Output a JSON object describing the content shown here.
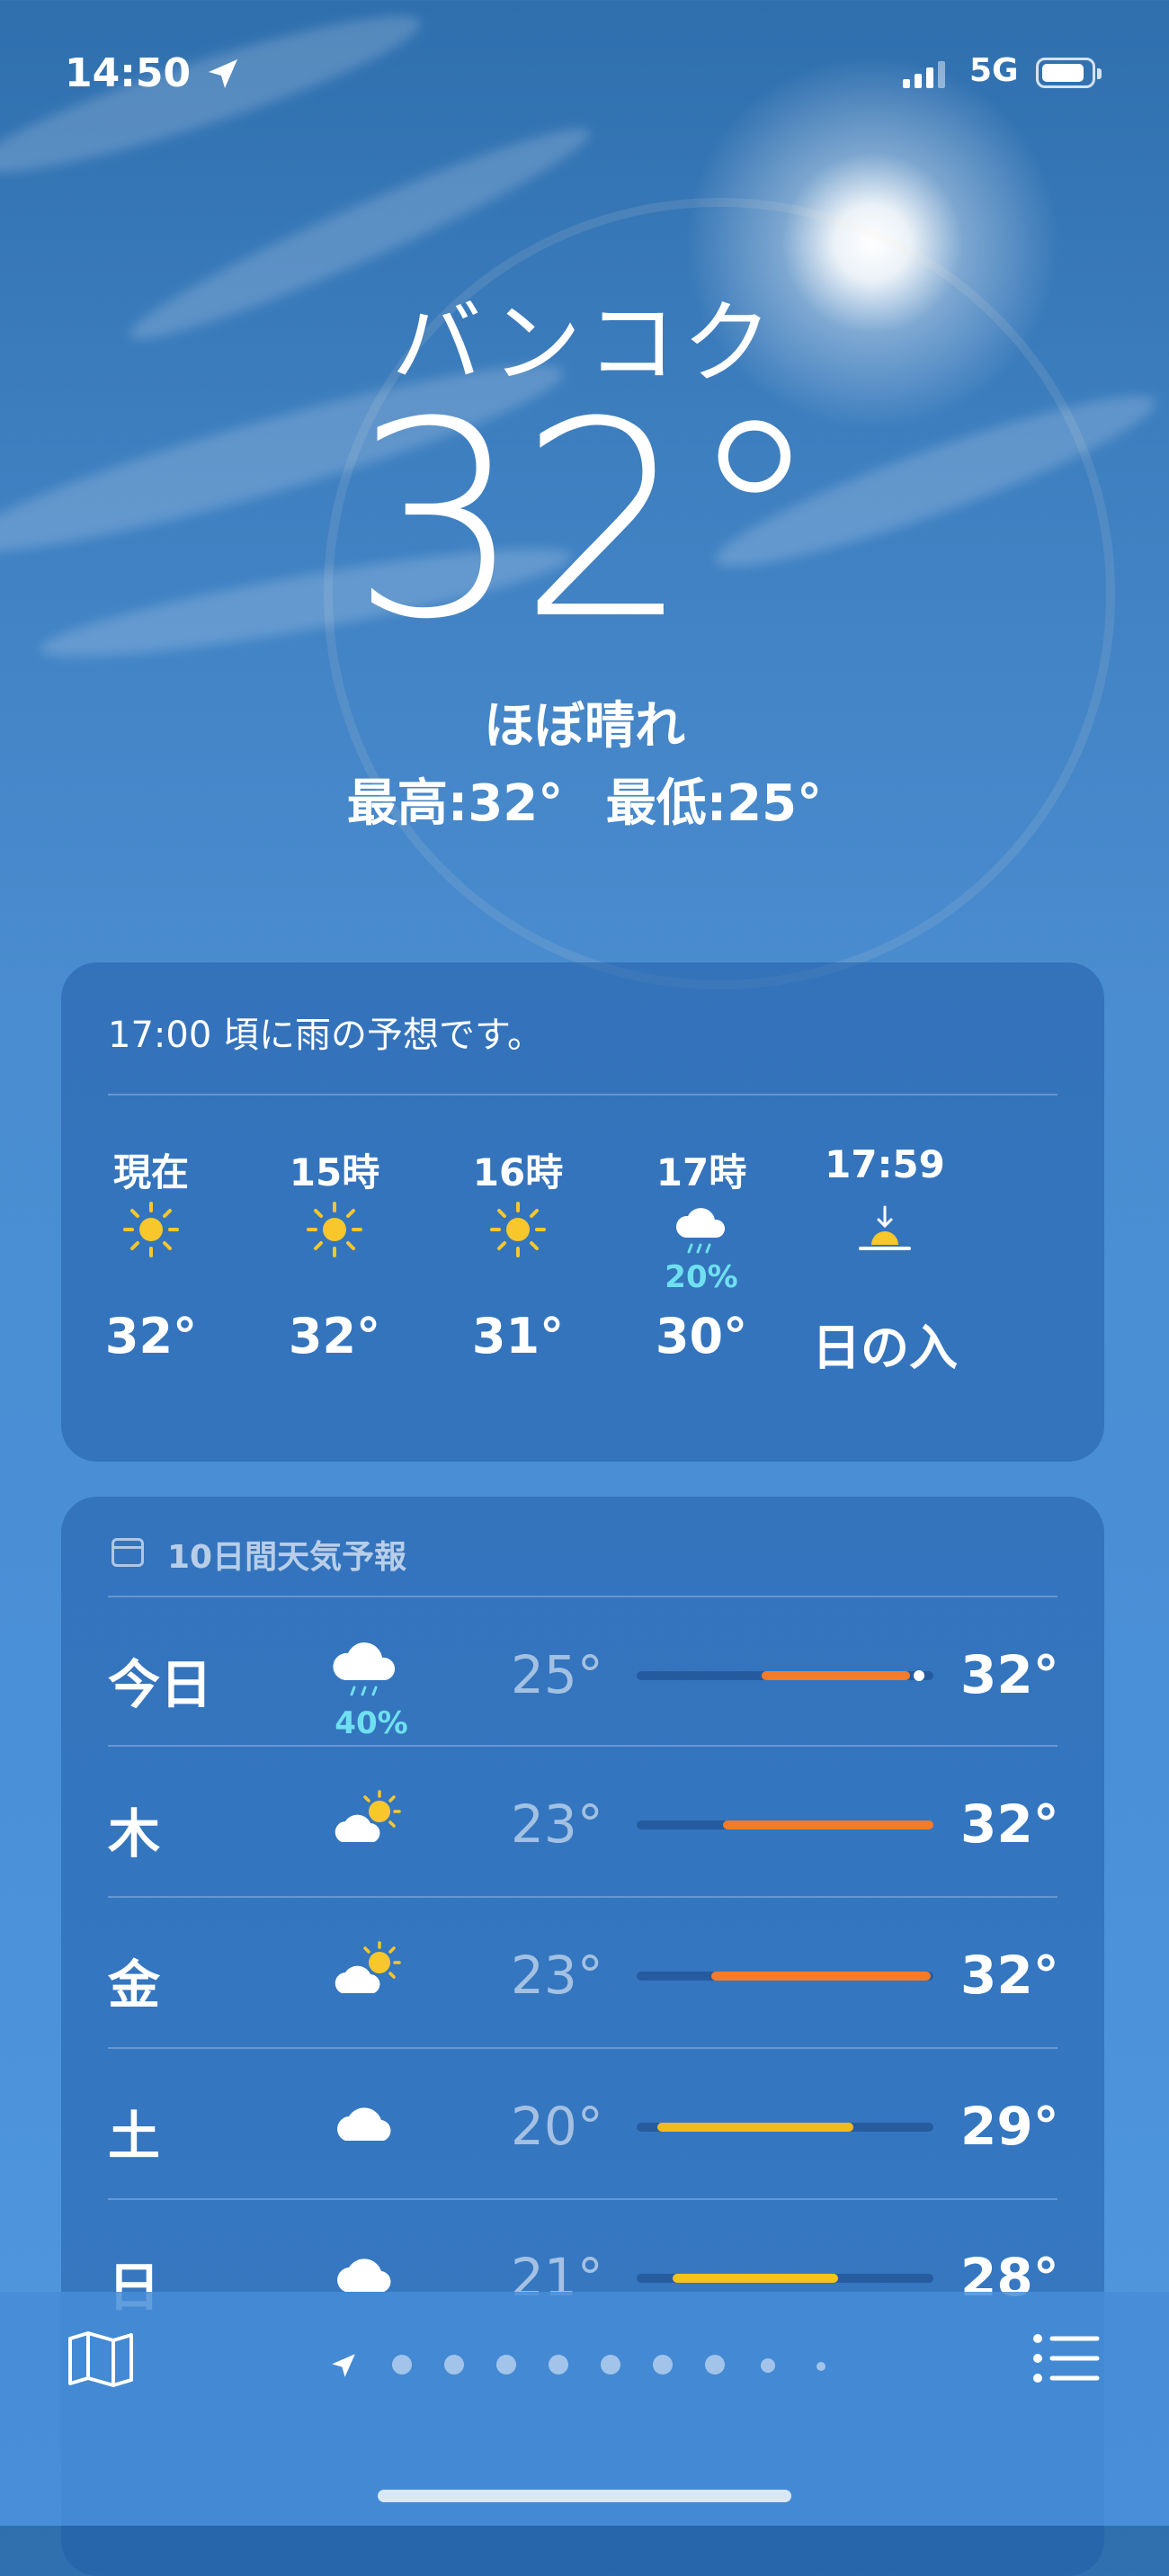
{
  "status_bar": {
    "time": "14:50",
    "network": "5G"
  },
  "current": {
    "city": "バンコク",
    "temperature": "32°",
    "condition": "ほぼ晴れ",
    "high": "最高:32°",
    "low": "最低:25°"
  },
  "hourly": {
    "alert": "17:00 頃に雨の予想です。",
    "items": [
      {
        "label": "現在",
        "icon": "sun-icon",
        "temp": "32°",
        "precip": ""
      },
      {
        "label": "15時",
        "icon": "sun-icon",
        "temp": "32°",
        "precip": ""
      },
      {
        "label": "16時",
        "icon": "sun-icon",
        "temp": "31°",
        "precip": ""
      },
      {
        "label": "17時",
        "icon": "rain-cloud-icon",
        "temp": "30°",
        "precip": "20%"
      },
      {
        "label": "17:59",
        "icon": "sunset-icon",
        "temp": "日の入",
        "precip": ""
      }
    ]
  },
  "forecast": {
    "title": "10日間天気予報",
    "days": [
      {
        "day": "今日",
        "icon": "rain-cloud-icon",
        "precip": "40%",
        "low": "25°",
        "high": "32°",
        "bar_start": 0.42,
        "bar_end": 0.92,
        "bar_color": "#f47b2a",
        "current_marker": 0.95
      },
      {
        "day": "木",
        "icon": "partly-sunny-icon",
        "precip": "",
        "low": "23°",
        "high": "32°",
        "bar_start": 0.29,
        "bar_end": 1.0,
        "bar_color": "#f47b2a"
      },
      {
        "day": "金",
        "icon": "partly-sunny-icon",
        "precip": "",
        "low": "23°",
        "high": "32°",
        "bar_start": 0.25,
        "bar_end": 0.99,
        "bar_color": "#f47b2a"
      },
      {
        "day": "土",
        "icon": "cloud-icon",
        "precip": "",
        "low": "20°",
        "high": "29°",
        "bar_start": 0.07,
        "bar_end": 0.73,
        "bar_color": "#f5b91f"
      },
      {
        "day": "日",
        "icon": "cloud-icon",
        "precip": "",
        "low": "21°",
        "high": "28°",
        "bar_start": 0.12,
        "bar_end": 0.68,
        "bar_color": "#f5c31f"
      }
    ]
  },
  "page_indicator": {
    "count": 9,
    "active": 0
  }
}
